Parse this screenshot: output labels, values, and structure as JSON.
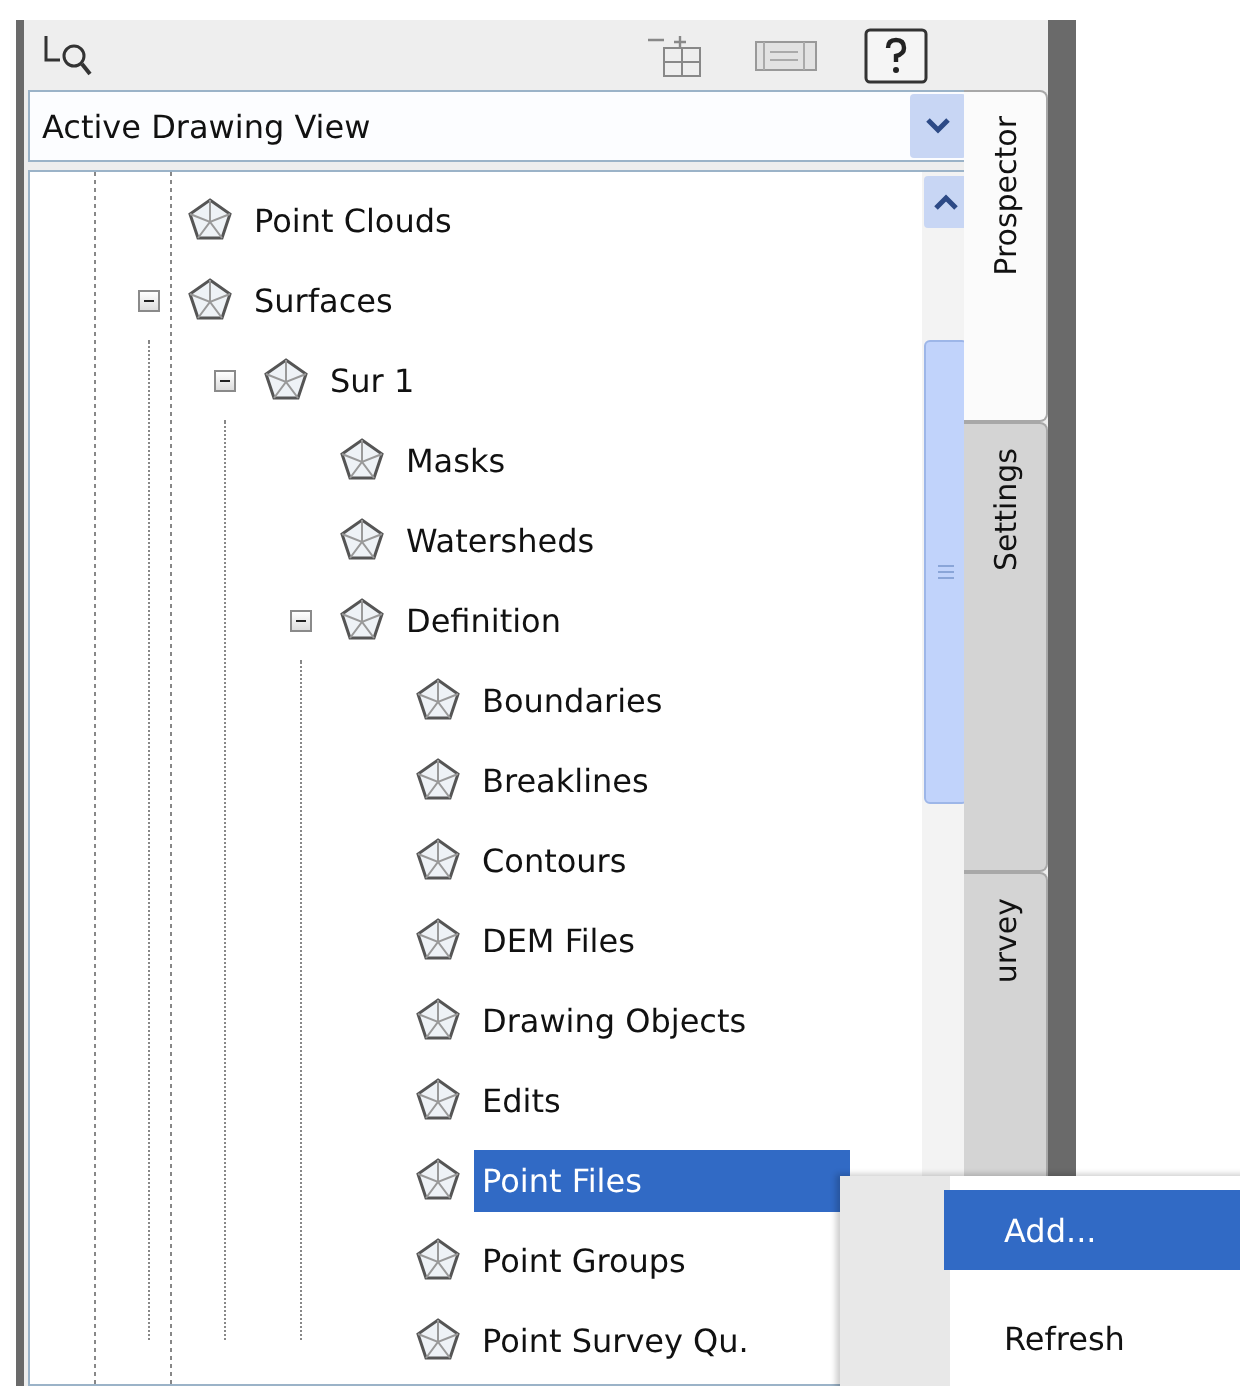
{
  "view_selector": {
    "value": "Active Drawing View"
  },
  "tree": [
    {
      "label": "Point Clouds",
      "selected": false
    },
    {
      "label": "Surfaces",
      "selected": false,
      "expanded": true,
      "children": [
        {
          "label": "Sur 1",
          "selected": false,
          "expanded": true,
          "children": [
            {
              "label": "Masks",
              "selected": false
            },
            {
              "label": "Watersheds",
              "selected": false
            },
            {
              "label": "Definition",
              "selected": false,
              "expanded": true,
              "children": [
                {
                  "label": "Boundaries",
                  "selected": false
                },
                {
                  "label": "Breaklines",
                  "selected": false
                },
                {
                  "label": "Contours",
                  "selected": false
                },
                {
                  "label": "DEM Files",
                  "selected": false
                },
                {
                  "label": "Drawing Objects",
                  "selected": false
                },
                {
                  "label": "Edits",
                  "selected": false
                },
                {
                  "label": "Point Files",
                  "selected": true
                },
                {
                  "label": "Point Groups",
                  "selected": false
                },
                {
                  "label": "Point Survey Qu.",
                  "selected": false
                }
              ]
            }
          ]
        }
      ]
    }
  ],
  "side_tabs": [
    {
      "label": "Prospector",
      "selected": true
    },
    {
      "label": "Settings",
      "selected": false
    },
    {
      "label": "urvey",
      "selected": false
    }
  ],
  "context_menu": [
    {
      "label": "Add...",
      "selected": true
    },
    {
      "label": "Refresh",
      "selected": false
    }
  ]
}
